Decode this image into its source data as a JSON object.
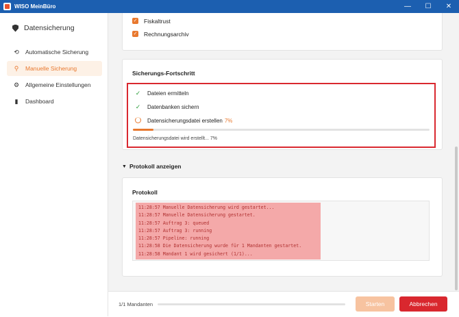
{
  "window": {
    "title": "WISO MeinBüro",
    "controls": [
      "—",
      "☐",
      "✕"
    ]
  },
  "sidebar": {
    "header": "Datensicherung",
    "items": [
      {
        "label": "Automatische Sicherung",
        "icon": "clock-refresh-icon",
        "glyph": "⟲"
      },
      {
        "label": "Manuelle Sicherung",
        "icon": "hand-icon",
        "glyph": "⚲"
      },
      {
        "label": "Allgemeine Einstellungen",
        "icon": "gear-icon",
        "glyph": "⚙"
      },
      {
        "label": "Dashboard",
        "icon": "bar-chart-icon",
        "glyph": "▮"
      }
    ]
  },
  "selection": {
    "items": [
      {
        "label": "Fiskaltrust",
        "checked": true
      },
      {
        "label": "Rechnungsarchiv",
        "checked": true
      }
    ]
  },
  "progress": {
    "title": "Sicherungs-Fortschritt",
    "steps": [
      {
        "label": "Dateien ermitteln",
        "status": "done",
        "glyph": "✓"
      },
      {
        "label": "Datenbanken sichern",
        "status": "done",
        "glyph": "✓"
      },
      {
        "label": "Datensicherungsdatei erstellen",
        "status": "running",
        "percent": "7%"
      }
    ],
    "bar_percent": 7,
    "status_text": "Datensicherungsdatei wird erstellt... 7%"
  },
  "protocol_toggle": {
    "label": "Protokoll anzeigen",
    "glyph": "▼"
  },
  "protocol": {
    "title": "Protokoll",
    "lines": [
      "11:28:57  Manuelle Datensicherung wird gestartet...",
      "11:28:57  Manuelle Datensicherung gestartet.",
      "11:28:57  Auftrag 3: queued",
      "11:28:57  Auftrag 3: running",
      "11:28:57  Pipeline: running",
      "11:28:58  Die Datensicherung wurde für 1 Mandanten gestartet.",
      "11:28:58  Mandant 1 wird gesichert (1/1)..."
    ]
  },
  "footer": {
    "count": "1/1 Mandanten",
    "start_label": "Starten",
    "cancel_label": "Abbrechen"
  },
  "colors": {
    "accent": "#e8782e",
    "danger": "#d9272e",
    "titlebar": "#1c5fb0",
    "success": "#2a9d3a"
  }
}
